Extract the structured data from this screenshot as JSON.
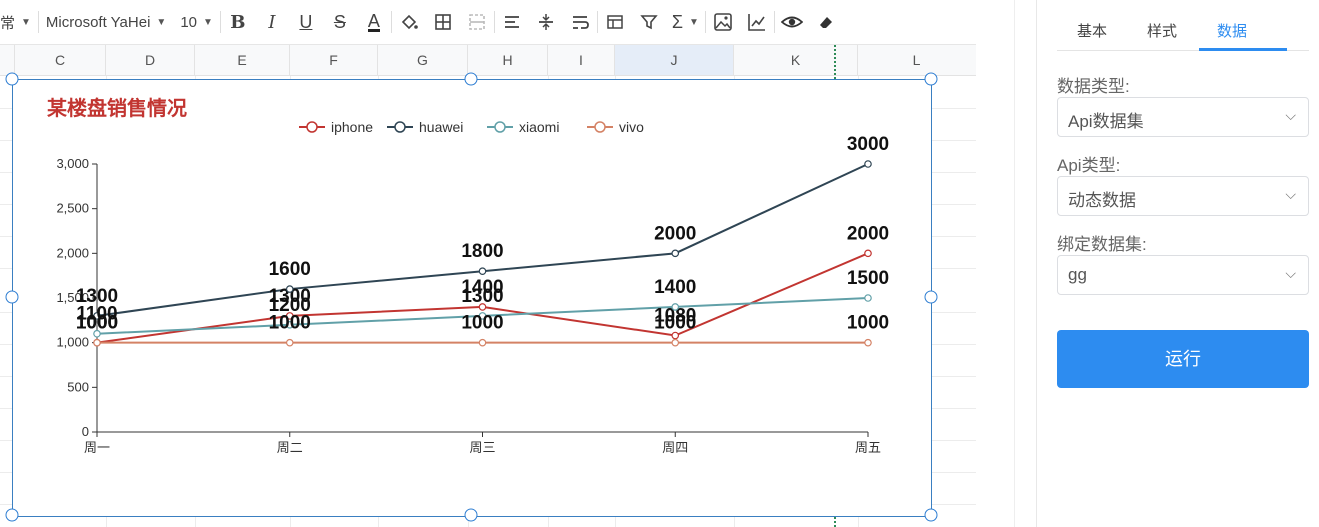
{
  "toolbar": {
    "style_label": "常",
    "font_name": "Microsoft YaHei",
    "font_size": "10",
    "icons": [
      "bold-icon",
      "italic-icon",
      "underline-icon",
      "strikethrough-icon",
      "font-color-icon",
      "fill-color-icon",
      "borders-icon",
      "merge-cells-icon",
      "align-horizontal-icon",
      "align-vertical-icon",
      "wrap-text-icon",
      "table-icon",
      "filter-icon",
      "sum-icon",
      "image-icon",
      "chart-icon",
      "preview-icon",
      "clear-icon"
    ]
  },
  "columns": [
    "C",
    "D",
    "E",
    "F",
    "G",
    "H",
    "I",
    "J",
    "K",
    "L"
  ],
  "chart_data": {
    "type": "line",
    "title": "某楼盘销售情况",
    "categories": [
      "周一",
      "周二",
      "周三",
      "周四",
      "周五"
    ],
    "series": [
      {
        "name": "iphone",
        "values": [
          1000,
          1300,
          1400,
          1080,
          2000
        ],
        "color": "#c23531"
      },
      {
        "name": "huawei",
        "values": [
          1300,
          1600,
          1800,
          2000,
          3000
        ],
        "color": "#2f4554"
      },
      {
        "name": "xiaomi",
        "values": [
          1100,
          1200,
          1300,
          1400,
          1500
        ],
        "color": "#61a0a8"
      },
      {
        "name": "vivo",
        "values": [
          1000,
          1000,
          1000,
          1000,
          1000
        ],
        "color": "#d48265"
      }
    ],
    "ylim": [
      0,
      3000
    ],
    "yticks": [
      "0",
      "500",
      "1,000",
      "1,500",
      "2,000",
      "2,500",
      "3,000"
    ],
    "legend_position": "top-center",
    "grid": false
  },
  "panel": {
    "tabs": [
      "基本",
      "样式",
      "数据"
    ],
    "active_tab": "数据",
    "data_type_label": "数据类型:",
    "data_type_value": "Api数据集",
    "api_type_label": "Api类型:",
    "api_type_value": "动态数据",
    "dataset_label": "绑定数据集:",
    "dataset_value": "gg",
    "run_button": "运行"
  }
}
